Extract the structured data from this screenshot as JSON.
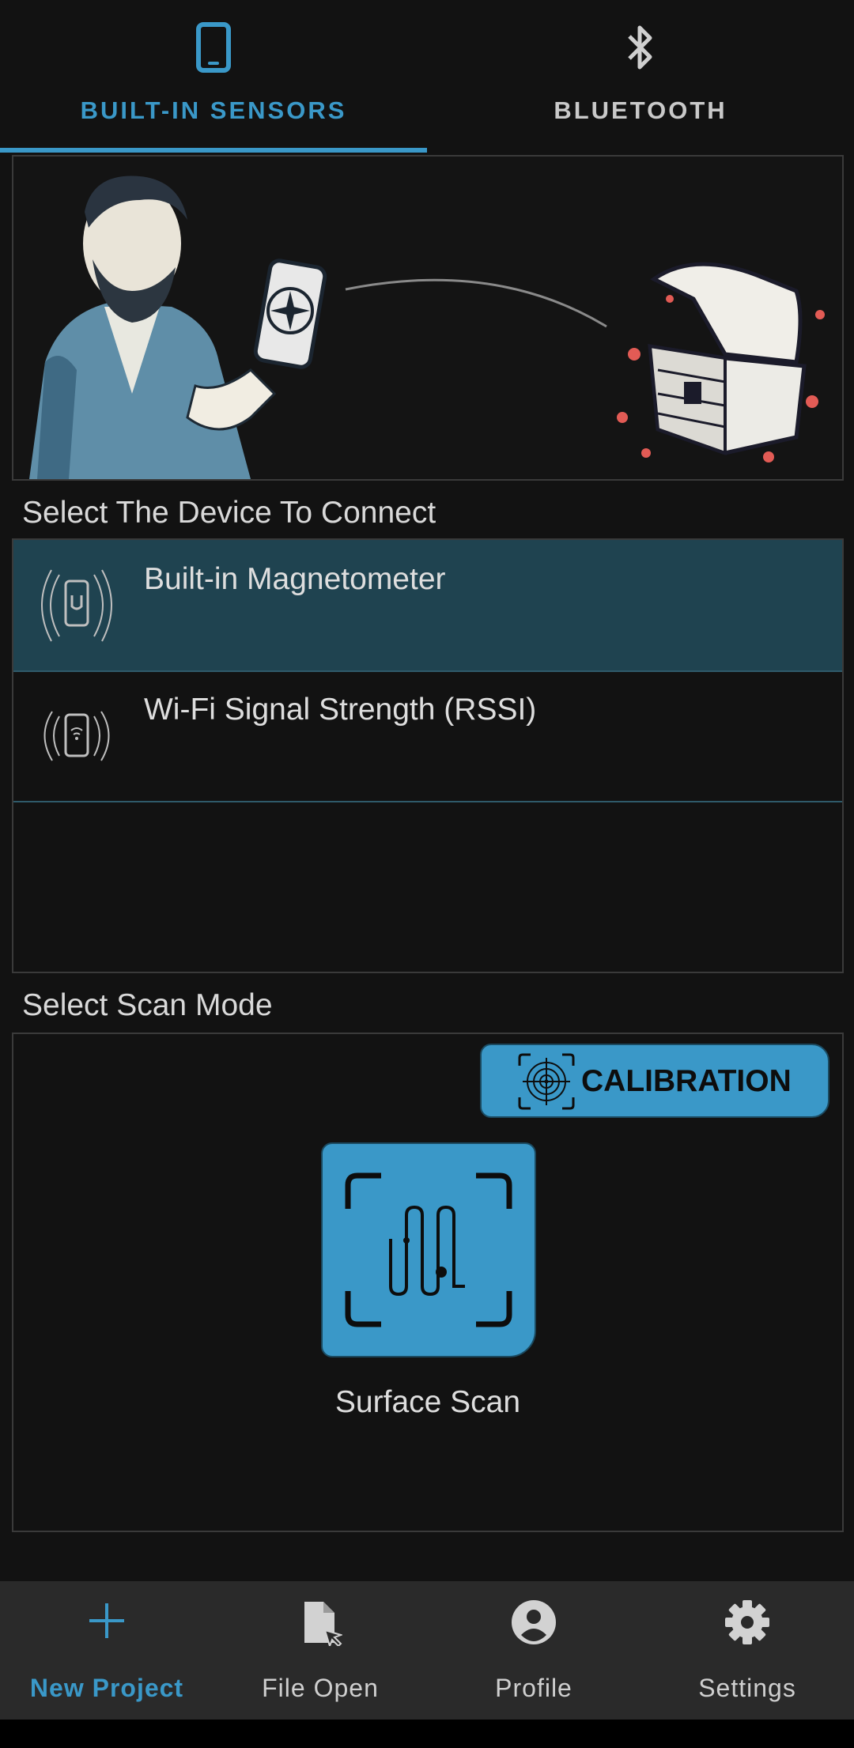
{
  "tabs": [
    {
      "label": "BUILT-IN SENSORS",
      "icon": "smartphone-icon",
      "active": true
    },
    {
      "label": "BLUETOOTH",
      "icon": "bluetooth-icon",
      "active": false
    }
  ],
  "device_section": {
    "title": "Select The Device To Connect",
    "devices": [
      {
        "label": "Built-in Magnetometer",
        "icon": "magnetometer-phone-icon",
        "selected": true
      },
      {
        "label": "Wi-Fi Signal Strength (RSSI)",
        "icon": "wifi-phone-icon",
        "selected": false
      }
    ]
  },
  "scan_section": {
    "title": "Select Scan Mode",
    "calibration_label": "CALIBRATION",
    "mode_label": "Surface Scan"
  },
  "bottom_nav": [
    {
      "label": "New Project",
      "icon": "plus-icon",
      "active": true
    },
    {
      "label": "File Open",
      "icon": "file-open-icon",
      "active": false
    },
    {
      "label": "Profile",
      "icon": "profile-icon",
      "active": false
    },
    {
      "label": "Settings",
      "icon": "gear-icon",
      "active": false
    }
  ],
  "colors": {
    "accent": "#3a98c8",
    "background": "#121212",
    "selected_row": "#1f4350",
    "nav_bar": "#2a2a2a"
  }
}
